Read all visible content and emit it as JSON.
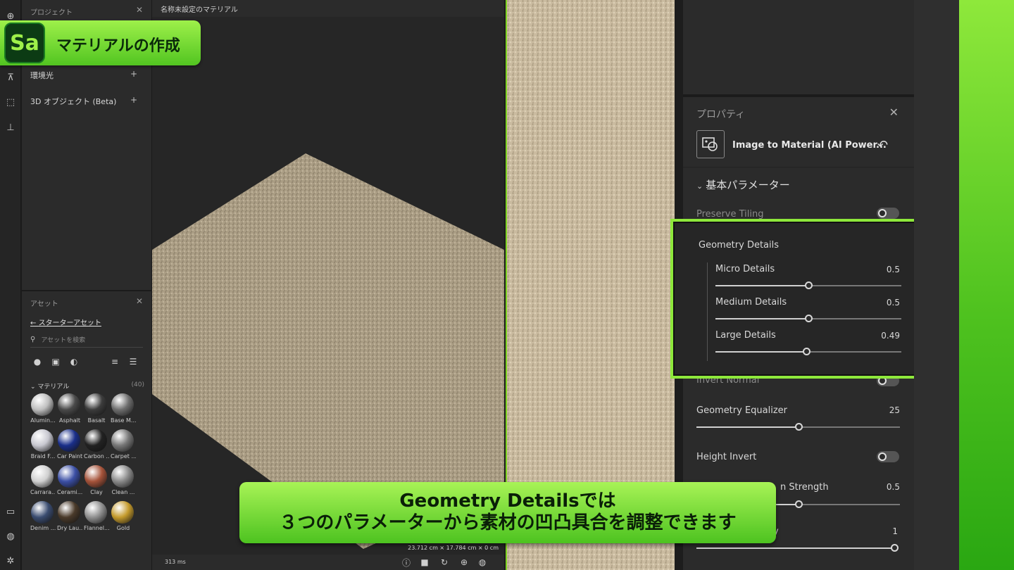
{
  "toolstrip": {
    "icons": [
      "add-icon",
      "lighting-icon",
      "transform-icon",
      "stamp-icon",
      "screen-icon",
      "world-icon",
      "settings-icon"
    ]
  },
  "project_panel": {
    "title": "プロジェクト",
    "items": [
      {
        "label": "環境光"
      },
      {
        "label": "3D オブジェクト (Beta)"
      }
    ]
  },
  "assets_panel": {
    "title": "アセット",
    "back_link": "スターターアセット",
    "search_placeholder": "アセットを検索",
    "materials_header": "マテリアル",
    "materials_count": "(40)",
    "materials": [
      {
        "label": "Alumin...",
        "color": "#bfbfbf"
      },
      {
        "label": "Asphalt",
        "color": "#4a4a4a"
      },
      {
        "label": "Basalt",
        "color": "#3c3c3c"
      },
      {
        "label": "Base M...",
        "color": "#6e6e6e"
      },
      {
        "label": "Braid F...",
        "color": "#c8c8d0"
      },
      {
        "label": "Car Paint",
        "color": "#1a2f8a"
      },
      {
        "label": "Carbon ...",
        "color": "#222222"
      },
      {
        "label": "Carpet ...",
        "color": "#777777"
      },
      {
        "label": "Carrara...",
        "color": "#d0d0d0"
      },
      {
        "label": "Cerami...",
        "color": "#3b4fa5"
      },
      {
        "label": "Clay",
        "color": "#a5533a"
      },
      {
        "label": "Clean ...",
        "color": "#8a8a8a"
      },
      {
        "label": "Denim ...",
        "color": "#3a4c70"
      },
      {
        "label": "Dry Lau...",
        "color": "#4a3a2a"
      },
      {
        "label": "Flannel...",
        "color": "#8f8f8f"
      },
      {
        "label": "Gold",
        "color": "#c49a2c"
      }
    ]
  },
  "viewport": {
    "title": "名称未設定のマテリアル",
    "render_time": "313 ms",
    "dimensions": "23.712 cm × 17.784 cm × 0 cm"
  },
  "properties": {
    "title": "プロパティ",
    "filter_name": "Image to Material (AI Power...",
    "section": "基本パラメーター",
    "preserve_tiling": {
      "label": "Preserve Tiling"
    },
    "geometry_details": {
      "label": "Geometry Details",
      "micro": {
        "label": "Micro Details",
        "value": "0.5",
        "fraction": 0.5
      },
      "medium": {
        "label": "Medium Details",
        "value": "0.5",
        "fraction": 0.5
      },
      "large": {
        "label": "Large Details",
        "value": "0.49",
        "fraction": 0.49
      }
    },
    "invert_normal": {
      "label": "Invert Normal"
    },
    "geometry_equalizer": {
      "label": "Geometry Equalizer",
      "value": "25",
      "fraction": 0.5
    },
    "height_invert": {
      "label": "Height Invert"
    },
    "strength": {
      "label": "n Strength",
      "value": "0.5",
      "fraction": 0.5
    },
    "last_param": {
      "label": "y",
      "value": "1",
      "fraction": 1.0
    }
  },
  "overlay": {
    "badge_logo": "Sa",
    "badge_title": "マテリアルの作成",
    "caption_line1": "Geometry Detailsでは",
    "caption_line2": "３つのパラメーターから素材の凹凸具合を調整できます"
  },
  "colors": {
    "accent_green": "#8ee83b",
    "texture": "#c9bba1"
  }
}
